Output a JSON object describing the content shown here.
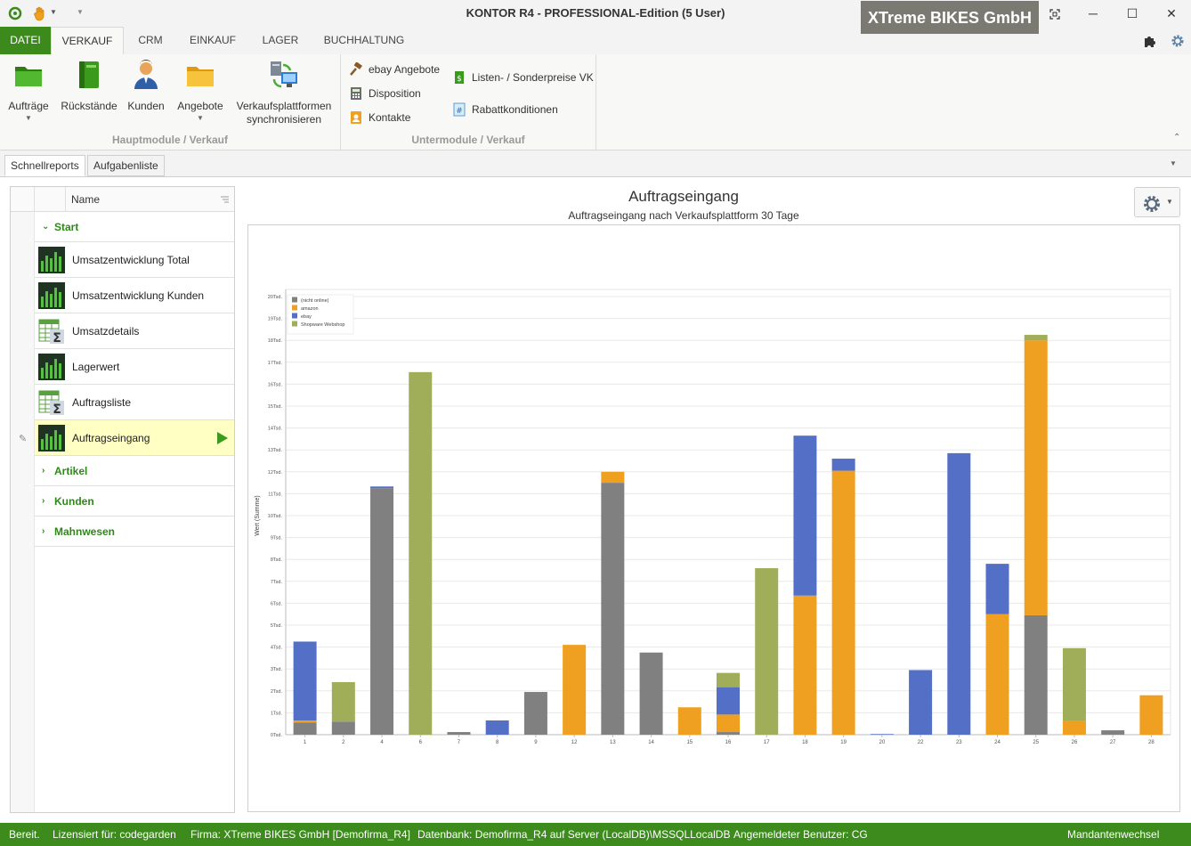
{
  "titlebar": {
    "title": "KONTOR R4 - PROFESSIONAL-Edition (5 User)",
    "company": "XTreme BIKES GmbH",
    "controls": [
      "fullscreen-icon",
      "minimize-icon",
      "maximize-icon",
      "close-icon"
    ]
  },
  "ribbon_tabs": [
    "DATEI",
    "VERKAUF",
    "CRM",
    "EINKAUF",
    "LAGER",
    "BUCHHALTUNG"
  ],
  "ribbon": {
    "main_group": {
      "label": "Hauptmodule / Verkauf",
      "buttons": [
        {
          "label": "Aufträge",
          "icon": "green-folder-icon"
        },
        {
          "label": "Rückstände",
          "icon": "green-book-icon"
        },
        {
          "label": "Kunden",
          "icon": "person-icon"
        },
        {
          "label": "Angebote",
          "icon": "yellow-folder-icon"
        },
        {
          "label_line1": "Verkaufsplattformen",
          "label_line2": "synchronisieren",
          "icon": "sync-monitor-icon"
        }
      ]
    },
    "sub_group": {
      "label": "Untermodule / Verkauf",
      "items": [
        {
          "label": "ebay Angebote",
          "icon": "gavel-icon"
        },
        {
          "label": "Disposition",
          "icon": "calculator-icon"
        },
        {
          "label": "Kontakte",
          "icon": "address-book-icon"
        },
        {
          "label": "Listen- / Sonderpreise VK",
          "icon": "price-list-icon"
        },
        {
          "label": "Rabattkonditionen",
          "icon": "discount-icon"
        }
      ]
    }
  },
  "doc_tabs": [
    "Schnellreports",
    "Aufgabenliste"
  ],
  "nav": {
    "header": "Name",
    "start_group": "Start",
    "reports": [
      {
        "label": "Umsatzentwicklung Total",
        "icon": "bar-report-icon"
      },
      {
        "label": "Umsatzentwicklung Kunden",
        "icon": "bar-report-icon"
      },
      {
        "label": "Umsatzdetails",
        "icon": "sum-table-icon"
      },
      {
        "label": "Lagerwert",
        "icon": "bar-report-icon"
      },
      {
        "label": "Auftragsliste",
        "icon": "sum-table-icon"
      },
      {
        "label": "Auftragseingang",
        "icon": "bar-report-icon"
      }
    ],
    "groups": [
      "Artikel",
      "Kunden",
      "Mahnwesen"
    ]
  },
  "chart_data": {
    "type": "bar",
    "stacked": true,
    "title": "Auftragseingang",
    "subtitle": "Auftragseingang nach Verkaufsplattform 30 Tage",
    "ylabel": "Wert (Summe)",
    "xlabel": "",
    "ylim": [
      0,
      20000
    ],
    "y_ticks": [
      "0Tsd.",
      "1Tsd.",
      "2Tsd.",
      "3Tsd.",
      "4Tsd.",
      "5Tsd.",
      "6Tsd.",
      "7Tsd.",
      "8Tsd.",
      "9Tsd.",
      "10Tsd.",
      "11Tsd.",
      "12Tsd.",
      "13Tsd.",
      "14Tsd.",
      "15Tsd.",
      "16Tsd.",
      "17Tsd.",
      "18Tsd.",
      "19Tsd.",
      "20Tsd."
    ],
    "grid": true,
    "legend_position": "top-left",
    "categories": [
      "1",
      "2",
      "4",
      "6",
      "7",
      "8",
      "9",
      "12",
      "13",
      "14",
      "15",
      "16",
      "17",
      "18",
      "19",
      "20",
      "22",
      "23",
      "24",
      "25",
      "26",
      "27",
      "28"
    ],
    "series": [
      {
        "name": "(nicht online)",
        "color": "#808080",
        "values": [
          550,
          600,
          11250,
          0,
          120,
          0,
          1950,
          0,
          11500,
          3750,
          0,
          120,
          0,
          0,
          0,
          0,
          0,
          0,
          0,
          5450,
          0,
          200,
          0
        ]
      },
      {
        "name": "amazon",
        "color": "#f0a020",
        "values": [
          100,
          0,
          0,
          0,
          0,
          0,
          0,
          4100,
          500,
          0,
          1250,
          800,
          0,
          6350,
          12050,
          0,
          0,
          0,
          5500,
          12550,
          650,
          0,
          1800
        ]
      },
      {
        "name": "ebay",
        "color": "#5470c6",
        "values": [
          3600,
          0,
          80,
          0,
          0,
          650,
          0,
          0,
          0,
          0,
          0,
          1250,
          0,
          7300,
          550,
          30,
          2950,
          12850,
          2300,
          0,
          0,
          0,
          0
        ]
      },
      {
        "name": "Shopware Webshop",
        "color": "#a0ae5a",
        "values": [
          0,
          1800,
          0,
          16550,
          0,
          0,
          0,
          0,
          0,
          0,
          0,
          650,
          7600,
          0,
          0,
          0,
          0,
          0,
          0,
          250,
          3300,
          0,
          0
        ]
      }
    ]
  },
  "status": {
    "ready": "Bereit.",
    "license": "Lizensiert für: codegarden",
    "company": "Firma: XTreme BIKES GmbH [Demofirma_R4]",
    "database": "Datenbank: Demofirma_R4 auf Server (LocalDB)\\MSSQLLocalDB",
    "user": "Angemeldeter Benutzer: CG",
    "switch": "Mandantenwechsel"
  }
}
